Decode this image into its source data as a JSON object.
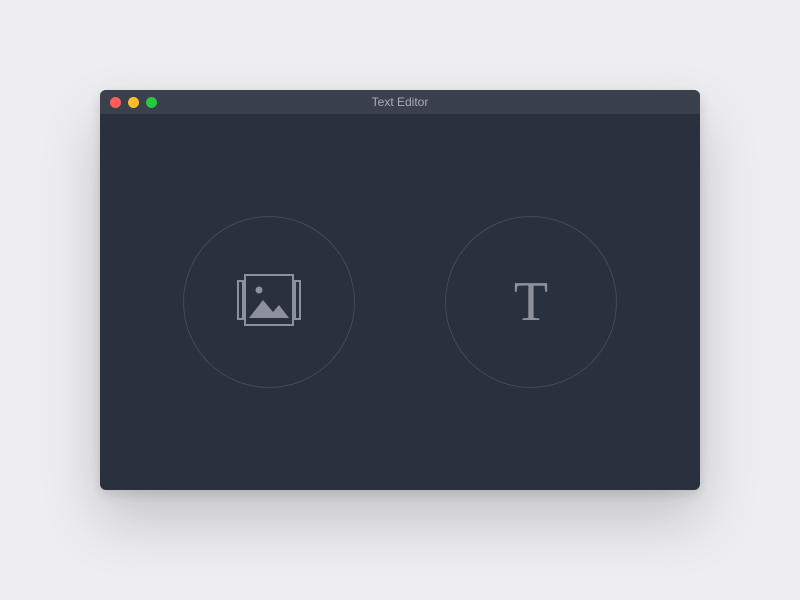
{
  "window": {
    "title": "Text Editor"
  },
  "options": {
    "image": {
      "icon_name": "image-gallery-icon"
    },
    "text": {
      "icon_name": "text-icon",
      "glyph": "T"
    }
  },
  "colors": {
    "page_bg": "#eeeef1",
    "window_bg": "#2a313e",
    "titlebar_bg": "#3b414c",
    "icon": "#8c919b"
  }
}
